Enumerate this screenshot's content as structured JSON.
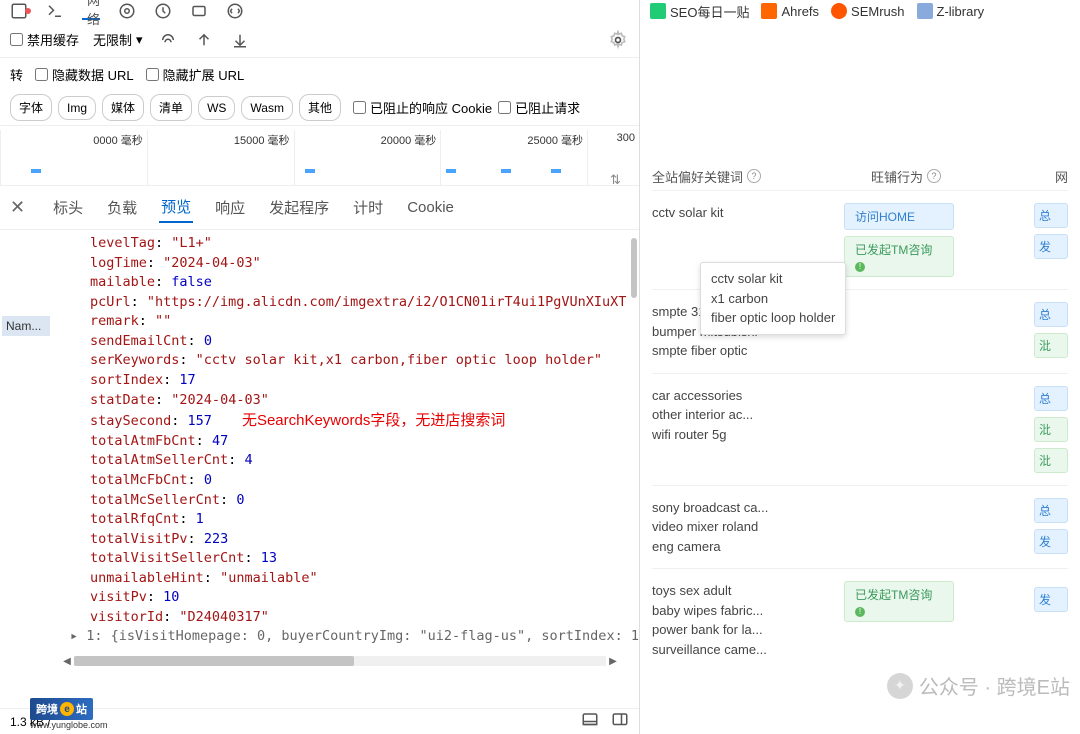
{
  "toolbar": {
    "network_label": "网络",
    "disable_cache": "禁用缓存",
    "throttle": "无限制"
  },
  "filter": {
    "zhuan": "转",
    "hide_data_url": "隐藏数据 URL",
    "hide_ext_url": "隐藏扩展 URL",
    "chips": [
      "字体",
      "Img",
      "媒体",
      "清单",
      "WS",
      "Wasm",
      "其他"
    ],
    "blocked_cookie": "已阻止的响应 Cookie",
    "blocked_req": "已阻止请求"
  },
  "timeline": {
    "marks": [
      "0000 毫秒",
      "15000 毫秒",
      "20000 毫秒",
      "25000 毫秒",
      "300"
    ]
  },
  "row_name": "Nam...",
  "detail_tabs": {
    "headers": "标头",
    "payload": "负载",
    "preview": "预览",
    "response": "响应",
    "initiator": "发起程序",
    "timing": "计时",
    "cookie": "Cookie"
  },
  "json": {
    "levelTag_k": "levelTag",
    "levelTag_v": "\"L1+\"",
    "logTime_k": "logTime",
    "logTime_v": "\"2024-04-03\"",
    "mailable_k": "mailable",
    "mailable_v": "false",
    "pcUrl_k": "pcUrl",
    "pcUrl_v": "\"https://img.alicdn.com/imgextra/i2/O1CN01irT4ui1PgVUnXIuXT",
    "remark_k": "remark",
    "remark_v": "\"\"",
    "sendEmailCnt_k": "sendEmailCnt",
    "sendEmailCnt_v": "0",
    "serKeywords_k": "serKeywords",
    "serKeywords_v": "\"cctv solar kit,x1 carbon,fiber optic loop holder\"",
    "sortIndex_k": "sortIndex",
    "sortIndex_v": "17",
    "statDate_k": "statDate",
    "statDate_v": "\"2024-04-03\"",
    "staySecond_k": "staySecond",
    "staySecond_v": "157",
    "totalAtmFbCnt_k": "totalAtmFbCnt",
    "totalAtmFbCnt_v": "47",
    "totalAtmSellerCnt_k": "totalAtmSellerCnt",
    "totalAtmSellerCnt_v": "4",
    "totalMcFbCnt_k": "totalMcFbCnt",
    "totalMcFbCnt_v": "0",
    "totalMcSellerCnt_k": "totalMcSellerCnt",
    "totalMcSellerCnt_v": "0",
    "totalRfqCnt_k": "totalRfqCnt",
    "totalRfqCnt_v": "1",
    "totalVisitPv_k": "totalVisitPv",
    "totalVisitPv_v": "223",
    "totalVisitSellerCnt_k": "totalVisitSellerCnt",
    "totalVisitSellerCnt_v": "13",
    "unmailableHint_k": "unmailableHint",
    "unmailableHint_v": "\"unmailable\"",
    "visitPv_k": "visitPv",
    "visitPv_v": "10",
    "visitorId_k": "visitorId",
    "visitorId_v": "\"D24040317\"",
    "trailing": "1: {isVisitHomepage: 0, buyerCountryImg: \"ui2-flag-us\", sortIndex: 1",
    "annotation": "无SearchKeywords字段，无进店搜索词"
  },
  "bottom": {
    "size": "1.3 kB /"
  },
  "bookmarks": {
    "b1": "SEO每日一贴",
    "b2": "Ahrefs",
    "b3": "SEMrush",
    "b4": "Z-library"
  },
  "right": {
    "col_kw": "全站偏好关键词",
    "col_behavior": "旺铺行为",
    "col_net": "网",
    "badge_home": "访问HOME",
    "badge_tm": "已发起TM咨询",
    "stat_total": "总",
    "stat_zi": "沘",
    "stat_fa": "发",
    "rows": [
      {
        "kw": [
          "cctv solar kit"
        ]
      },
      {
        "kw": [
          "smpte 311",
          "bumper mitsubishi",
          "smpte fiber optic"
        ]
      },
      {
        "kw": [
          "car accessories",
          "other interior ac...",
          "wifi router 5g"
        ]
      },
      {
        "kw": [
          "sony broadcast ca...",
          "video mixer roland",
          "eng camera"
        ]
      },
      {
        "kw": [
          "toys sex adult",
          "baby wipes fabric...",
          "power bank for la...",
          "surveillance came..."
        ]
      }
    ],
    "tooltip": [
      "cctv solar kit",
      "x1 carbon",
      "fiber optic loop holder"
    ]
  },
  "watermark": "公众号 · 跨境E站",
  "logo": {
    "text": "跨境",
    "e": "e",
    "suffix": "站",
    "url": "www.yunglobe.com"
  }
}
